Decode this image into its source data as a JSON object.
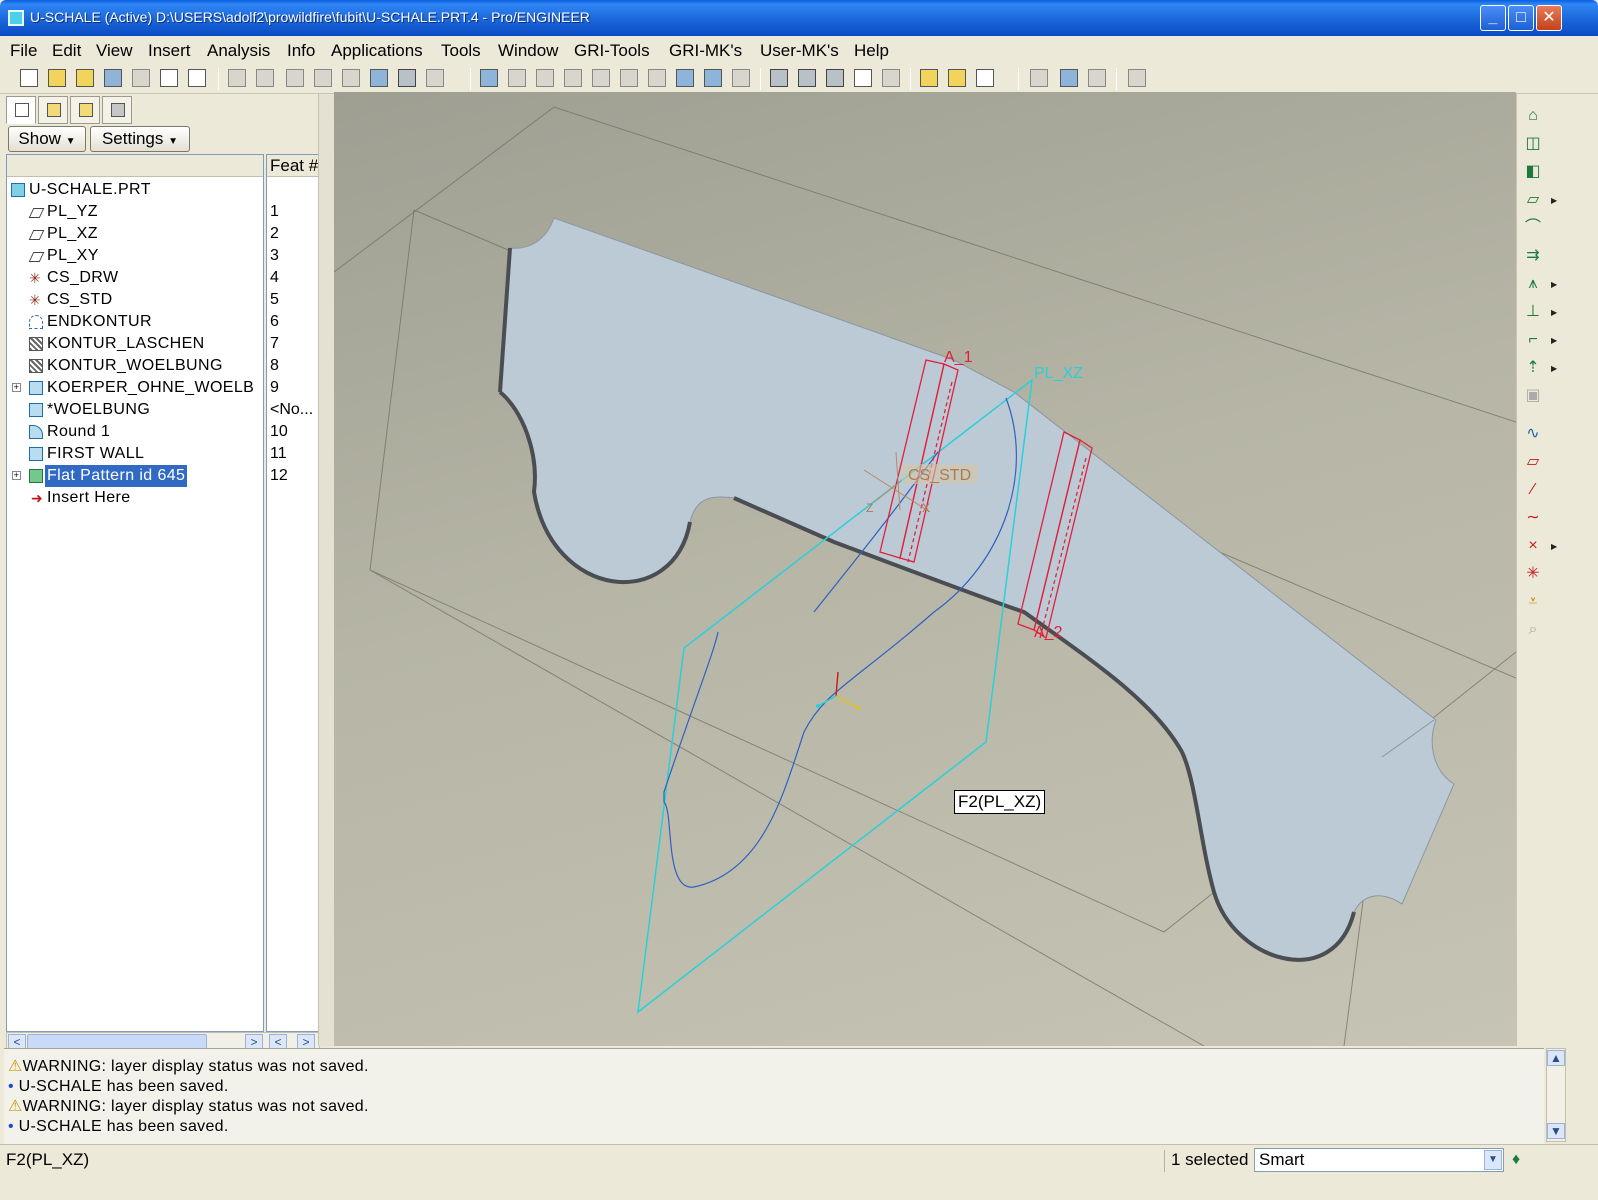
{
  "window": {
    "title": "U-SCHALE (Active) D:\\USERS\\adolf2\\prowildfire\\fubit\\U-SCHALE.PRT.4 - Pro/ENGINEER",
    "minimize_glyph": "_",
    "maximize_glyph": "□",
    "close_glyph": "✕"
  },
  "menu": [
    "File",
    "Edit",
    "View",
    "Insert",
    "Analysis",
    "Info",
    "Applications",
    "Tools",
    "Window",
    "GRI-Tools",
    "GRI-MK's",
    "User-MK's",
    "Help"
  ],
  "toolbar_icons": [
    "new-icon",
    "open-icon",
    "open-recent-icon",
    "save-icon",
    "print-icon",
    "save-as-icon",
    "edit-icon",
    "undo-icon",
    "redo-icon",
    "copy-icon",
    "paste-icon",
    "paste-special-icon",
    "regenerate-icon",
    "find-icon",
    "select-box-icon",
    "repaint-icon",
    "orient-icon",
    "zoom-in-icon",
    "zoom-out-icon",
    "refit-icon",
    "reorient-icon",
    "saved-views-icon",
    "layers-icon",
    "view-manager-icon",
    "wireframe-icon",
    "hidden-line-icon",
    "no-hidden-icon",
    "shading-icon",
    "spin-center-icon",
    "datum-planes-icon",
    "datum-axes-icon",
    "datum-points-icon",
    "csys-icon",
    "annotations-icon",
    "close-window-icon",
    "context-help-icon"
  ],
  "model_tree": {
    "show_label": "Show",
    "settings_label": "Settings",
    "column_header": "Feat #",
    "items": [
      {
        "label": "U-SCHALE.PRT",
        "feat": "",
        "icon": "part-icon"
      },
      {
        "label": "PL_YZ",
        "feat": "1",
        "icon": "datum-plane-icon"
      },
      {
        "label": "PL_XZ",
        "feat": "2",
        "icon": "datum-plane-icon"
      },
      {
        "label": "PL_XY",
        "feat": "3",
        "icon": "datum-plane-icon"
      },
      {
        "label": "CS_DRW",
        "feat": "4",
        "icon": "csys-icon"
      },
      {
        "label": "CS_STD",
        "feat": "5",
        "icon": "csys-icon"
      },
      {
        "label": "ENDKONTUR",
        "feat": "6",
        "icon": "sketch-icon"
      },
      {
        "label": "KONTUR_LASCHEN",
        "feat": "7",
        "icon": "hatch-icon"
      },
      {
        "label": "KONTUR_WOELBUNG",
        "feat": "8",
        "icon": "hatch-icon"
      },
      {
        "label": "KOERPER_OHNE_WOELB",
        "feat": "9",
        "icon": "feature-icon"
      },
      {
        "label": "*WOELBUNG",
        "feat": "<No...",
        "icon": "feature-icon"
      },
      {
        "label": "Round 1",
        "feat": "10",
        "icon": "round-icon"
      },
      {
        "label": "FIRST WALL",
        "feat": "11",
        "icon": "wall-icon"
      },
      {
        "label": "Flat Pattern id 645",
        "feat": "12",
        "icon": "flat-pattern-icon"
      },
      {
        "label": "Insert Here",
        "feat": "",
        "icon": "insert-arrow-icon"
      }
    ]
  },
  "graphics": {
    "labels": {
      "a1": "A_1",
      "a2": "A_2",
      "plane": "PL_XZ",
      "csys": "CS_STD",
      "csys_z": "Z",
      "csys_x": "X"
    },
    "tooltip": "F2(PL_XZ)",
    "colors": {
      "part": "#bccad6",
      "axis": "#e0203c",
      "plane": "#29d0d8",
      "sketch": "#3060c0"
    }
  },
  "right_toolbar_icons": [
    "hole-icon",
    "shell-icon",
    "rib-icon",
    "draft-icon",
    "round-icon",
    "chamfer-icon",
    "extend-icon",
    "merge-icon",
    "trim-icon",
    "offset-icon",
    "thicken-icon",
    "solidify-icon",
    "sketch-tool-icon",
    "datum-plane-tool-icon",
    "datum-axis-tool-icon",
    "datum-curve-tool-icon",
    "datum-point-tool-icon",
    "csys-tool-icon",
    "analysis-tool-icon",
    "cosmetic-icon"
  ],
  "messages": [
    {
      "type": "warning",
      "icon": "⚠",
      "text": "WARNING: layer display status was not saved."
    },
    {
      "type": "info",
      "icon": "•",
      "text": " U-SCHALE has been saved."
    },
    {
      "type": "warning",
      "icon": "⚠",
      "text": "WARNING: layer display status was not saved."
    },
    {
      "type": "info",
      "icon": "•",
      "text": " U-SCHALE has been saved."
    }
  ],
  "status": {
    "text": "F2(PL_XZ)",
    "selected": "1 selected",
    "filter": "Smart"
  }
}
